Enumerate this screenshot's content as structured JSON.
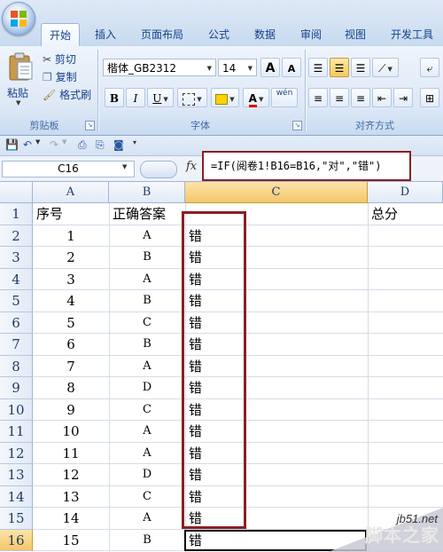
{
  "ribbon": {
    "tabs": [
      "开始",
      "插入",
      "页面布局",
      "公式",
      "数据",
      "审阅",
      "视图",
      "开发工具"
    ],
    "active_tab": "开始",
    "clipboard": {
      "paste_label": "粘贴",
      "cut_label": "剪切",
      "copy_label": "复制",
      "format_painter_label": "格式刷",
      "group_label": "剪贴板"
    },
    "font": {
      "family_value": "楷体_GB2312",
      "size_value": "14",
      "bold": "B",
      "italic": "I",
      "underline": "U",
      "grow": "A",
      "shrink": "A",
      "wen": "wén",
      "font_color": "A",
      "group_label": "字体"
    },
    "alignment": {
      "group_label": "对齐方式"
    }
  },
  "formula_bar": {
    "name_box": "C16",
    "fx_label": "fx",
    "formula": "=IF(阅卷1!B16=B16,\"对\",\"错\")"
  },
  "grid": {
    "columns": [
      "A",
      "B",
      "C",
      "D"
    ],
    "selected_column": "C",
    "row_numbers": [
      "1",
      "2",
      "3",
      "4",
      "5",
      "6",
      "7",
      "8",
      "9",
      "10",
      "11",
      "12",
      "13",
      "14",
      "15",
      "16"
    ],
    "selected_row": "16",
    "header_row": {
      "a": "序号",
      "b": "正确答案",
      "d": "总分"
    },
    "rows": [
      {
        "seq": "1",
        "answer": "A",
        "result": "错"
      },
      {
        "seq": "2",
        "answer": "B",
        "result": "错"
      },
      {
        "seq": "3",
        "answer": "A",
        "result": "错"
      },
      {
        "seq": "4",
        "answer": "B",
        "result": "错"
      },
      {
        "seq": "5",
        "answer": "C",
        "result": "错"
      },
      {
        "seq": "6",
        "answer": "B",
        "result": "错"
      },
      {
        "seq": "7",
        "answer": "A",
        "result": "错"
      },
      {
        "seq": "8",
        "answer": "D",
        "result": "错"
      },
      {
        "seq": "9",
        "answer": "C",
        "result": "错"
      },
      {
        "seq": "10",
        "answer": "A",
        "result": "错"
      },
      {
        "seq": "11",
        "answer": "A",
        "result": "错"
      },
      {
        "seq": "12",
        "answer": "D",
        "result": "错"
      },
      {
        "seq": "13",
        "answer": "C",
        "result": "错"
      },
      {
        "seq": "14",
        "answer": "A",
        "result": "错"
      },
      {
        "seq": "15",
        "answer": "B",
        "result": "错"
      }
    ]
  },
  "watermark": {
    "url": "jb51.net",
    "text": "脚本之家"
  },
  "colors": {
    "highlight_border": "#8b1f22",
    "selected_header": "#f4c76b",
    "ribbon_bg": "#dde8f6"
  }
}
